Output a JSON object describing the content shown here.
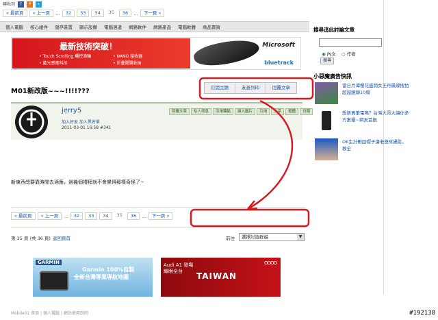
{
  "share": {
    "label": "轉貼到"
  },
  "pager": {
    "first": "« 最前頁",
    "prev": "« 上一頁",
    "dots": "...",
    "pages": [
      "32",
      "33",
      "34",
      "35",
      "36"
    ],
    "current": "35",
    "next": "下一頁 »"
  },
  "categories": [
    "個人電腦",
    "核心組件",
    "儲存裝置",
    "顯示設備",
    "電腦週邊",
    "網路軟件",
    "網路產品",
    "電腦軟體",
    "商品賣買"
  ],
  "banner": {
    "headline": "最新技術突破！",
    "bullets": [
      "• Touch Scrolling 觸控滾輪",
      "• 藍光感應科技",
      "• NANO 接收器",
      "• 折疊開關收納"
    ],
    "brand": "Microsoft",
    "tech": "bluetrack"
  },
  "topic": {
    "title": "M01新改版~~~!!!!???",
    "tabs": [
      "訂閱主題",
      "友善列印",
      "回覆文章"
    ]
  },
  "post": {
    "username": "jerry5",
    "user_links": "加入好友  加入黑名單",
    "time": "2011-03-01 16:58  #341",
    "actions": [
      "回覆文章",
      "私人訊息",
      "引用轉貼",
      "讓入圖片",
      "引用",
      "文章",
      "粗體",
      "日期"
    ],
    "body": "新東西總要靠時間去適應，過幾個禮拜就不會覺得那樣奇怪了~"
  },
  "status": {
    "page_info": "第 35 頁 (共 36 頁)",
    "back_link": "返回頁首",
    "goto_label": "前往",
    "goto_select": "選擇討論群組"
  },
  "ads": {
    "garmin_brand": "GARMIN",
    "garmin_line1": "Garmin 100%自製",
    "garmin_line2": "全新台灣專業導航地圖",
    "audi_line1": "Audi A1 登場",
    "audi_line2": "耀眼全台",
    "audi_big": "TAIWAN",
    "audi_rings": "OOOO"
  },
  "footer": "Mobile01 首頁  |  個人電腦  |  網站使用說明",
  "watermark": "#192138",
  "sidebar": {
    "search_title": "搜尋這此討論文章",
    "radio_content": "內文",
    "radio_author": "作者",
    "search_button": "搜尋",
    "news_title": "小惡魔廣告快訊",
    "items": [
      "當日月潭櫻花盛開女王丹鳳蝶搜拍超越鏡頭10周",
      "想新買筆電嗎？台灣大哥大讓你多方案優~網友首推",
      "OK生計劃回帽子讓老爸來攝影，教全"
    ]
  },
  "colors": {
    "annotation_red": "#d71920",
    "link_blue": "#1a56a8",
    "post_header_bg": "#f0f4ec"
  }
}
